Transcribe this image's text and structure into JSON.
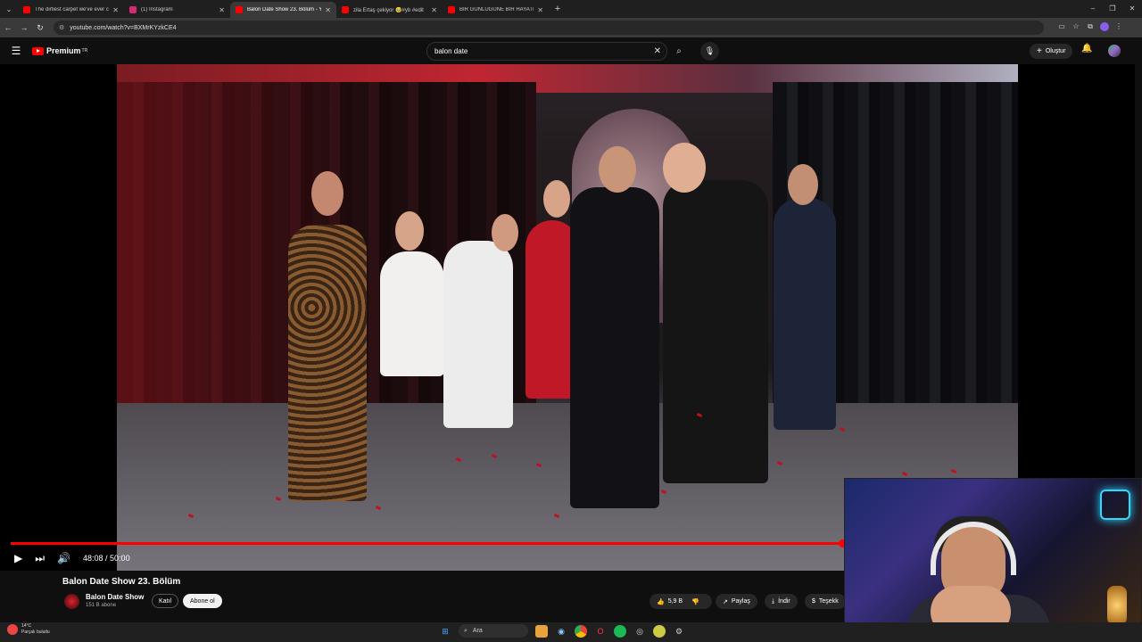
{
  "browser": {
    "tabs": [
      {
        "title": "The dirtiest carpet we've ever c",
        "favicon_color": "#ff0000",
        "active": false
      },
      {
        "title": "(1) Instagram",
        "favicon_color": "#d62976",
        "active": false
      },
      {
        "title": "Balon Date Show 23. Bölüm - Yo",
        "favicon_color": "#ff0000",
        "active": true
      },
      {
        "title": "zila Ertaş çekiyor 🥹#yb #edit",
        "favicon_color": "#ff0000",
        "active": false
      },
      {
        "title": "BİR GÜNLÜĞÜNE BİR HAYATI D",
        "favicon_color": "#ff0000",
        "active": false
      }
    ],
    "url": "youtube.com/watch?v=BXMrKYzkCE4"
  },
  "youtube": {
    "logo_text": "Premium",
    "logo_sup": "TR",
    "search_value": "balon date",
    "create_label": "Oluştur"
  },
  "player": {
    "current_time": "48:08",
    "duration": "50:00",
    "progress": 0.9627
  },
  "video_info": {
    "title": "Balon Date Show 23. Bölüm",
    "channel_name": "Balon Date Show",
    "subscribers": "151 B abone",
    "join_label": "Katıl",
    "subscribe_label": "Abone ol",
    "likes": "5,9 B",
    "share_label": "Paylaş",
    "download_label": "İndir",
    "thanks_label": "Teşekk"
  },
  "taskbar": {
    "weather_temp": "14°C",
    "weather_desc": "Parçalı bulutlu",
    "search_label": "Ara"
  },
  "colors": {
    "accent": "#ff0000",
    "background": "#0f0f0f"
  }
}
